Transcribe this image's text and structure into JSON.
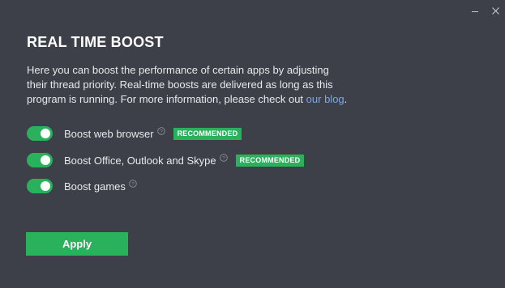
{
  "window": {
    "controls": {
      "minimize_icon": "minimize-icon",
      "close_icon": "close-icon"
    }
  },
  "header": {
    "title": "REAL TIME BOOST"
  },
  "description": {
    "text": "Here you can boost the performance of certain apps by adjusting their thread priority. Real-time boosts are delivered as long as this program is running. For more information, please check out ",
    "link_text": "our blog",
    "suffix": "."
  },
  "options": [
    {
      "label": "Boost web browser",
      "enabled": true,
      "badge": "RECOMMENDED"
    },
    {
      "label": "Boost Office, Outlook and Skype",
      "enabled": true,
      "badge": "RECOMMENDED"
    },
    {
      "label": "Boost games",
      "enabled": true,
      "badge": ""
    }
  ],
  "actions": {
    "apply_label": "Apply"
  },
  "colors": {
    "background": "#3e4049",
    "accent": "#2ab15c",
    "link": "#7aa7e8",
    "text": "#e8e9ec"
  }
}
